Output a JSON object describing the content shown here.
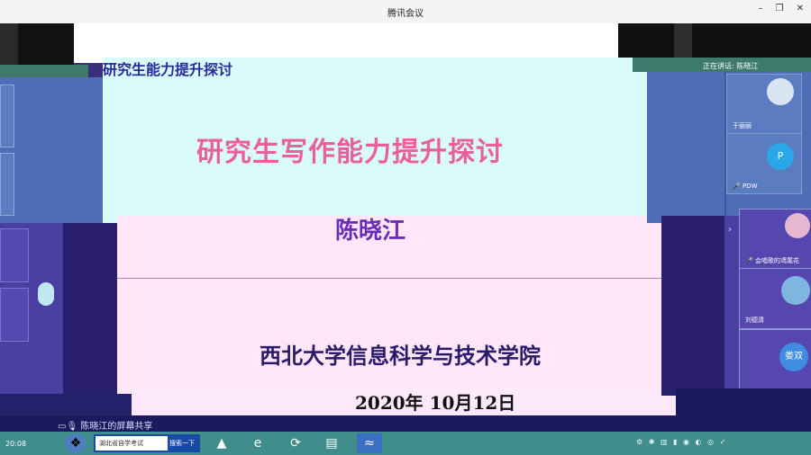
{
  "window": {
    "title": "腾讯会议",
    "minimize": "–",
    "restore": "❐",
    "close": "✕"
  },
  "slide": {
    "header": "研究生能力提升探讨",
    "title": "研究生写作能力提升探讨",
    "author": "陈晓江",
    "institute": "西北大学信息科学与技术学院",
    "date": "2020年 10月12日"
  },
  "meeting": {
    "speaking_label": "正在讲话: 陈晓江",
    "participants": [
      {
        "name": "于丽丽",
        "avatar_text": "",
        "avatar_color": "#d8e4f2"
      },
      {
        "name": "PDW",
        "avatar_text": "P",
        "avatar_color": "#2aa7e8"
      },
      {
        "name": "会唱歌的鸢尾花",
        "avatar_text": "",
        "avatar_color": "#e6b7cf"
      },
      {
        "name": "刘德清",
        "avatar_text": "",
        "avatar_color": "#7fb6e0"
      },
      {
        "name": "娄双",
        "avatar_text": "娄双",
        "avatar_color": "#3f8de0"
      }
    ],
    "share_label": "陈晓江的屏幕共享"
  },
  "taskbar": {
    "clock": "20:08",
    "search_text": "湖北省自学考试",
    "search_button": "搜索一下",
    "tray_icons": "⚙ ✱ ▥ ▮ ◉ ◐ ◎ ✓",
    "start_icon": "windows-start-icon",
    "apps": [
      "ie-icon",
      "update-icon",
      "explorer-icon",
      "meeting-app-icon"
    ]
  }
}
